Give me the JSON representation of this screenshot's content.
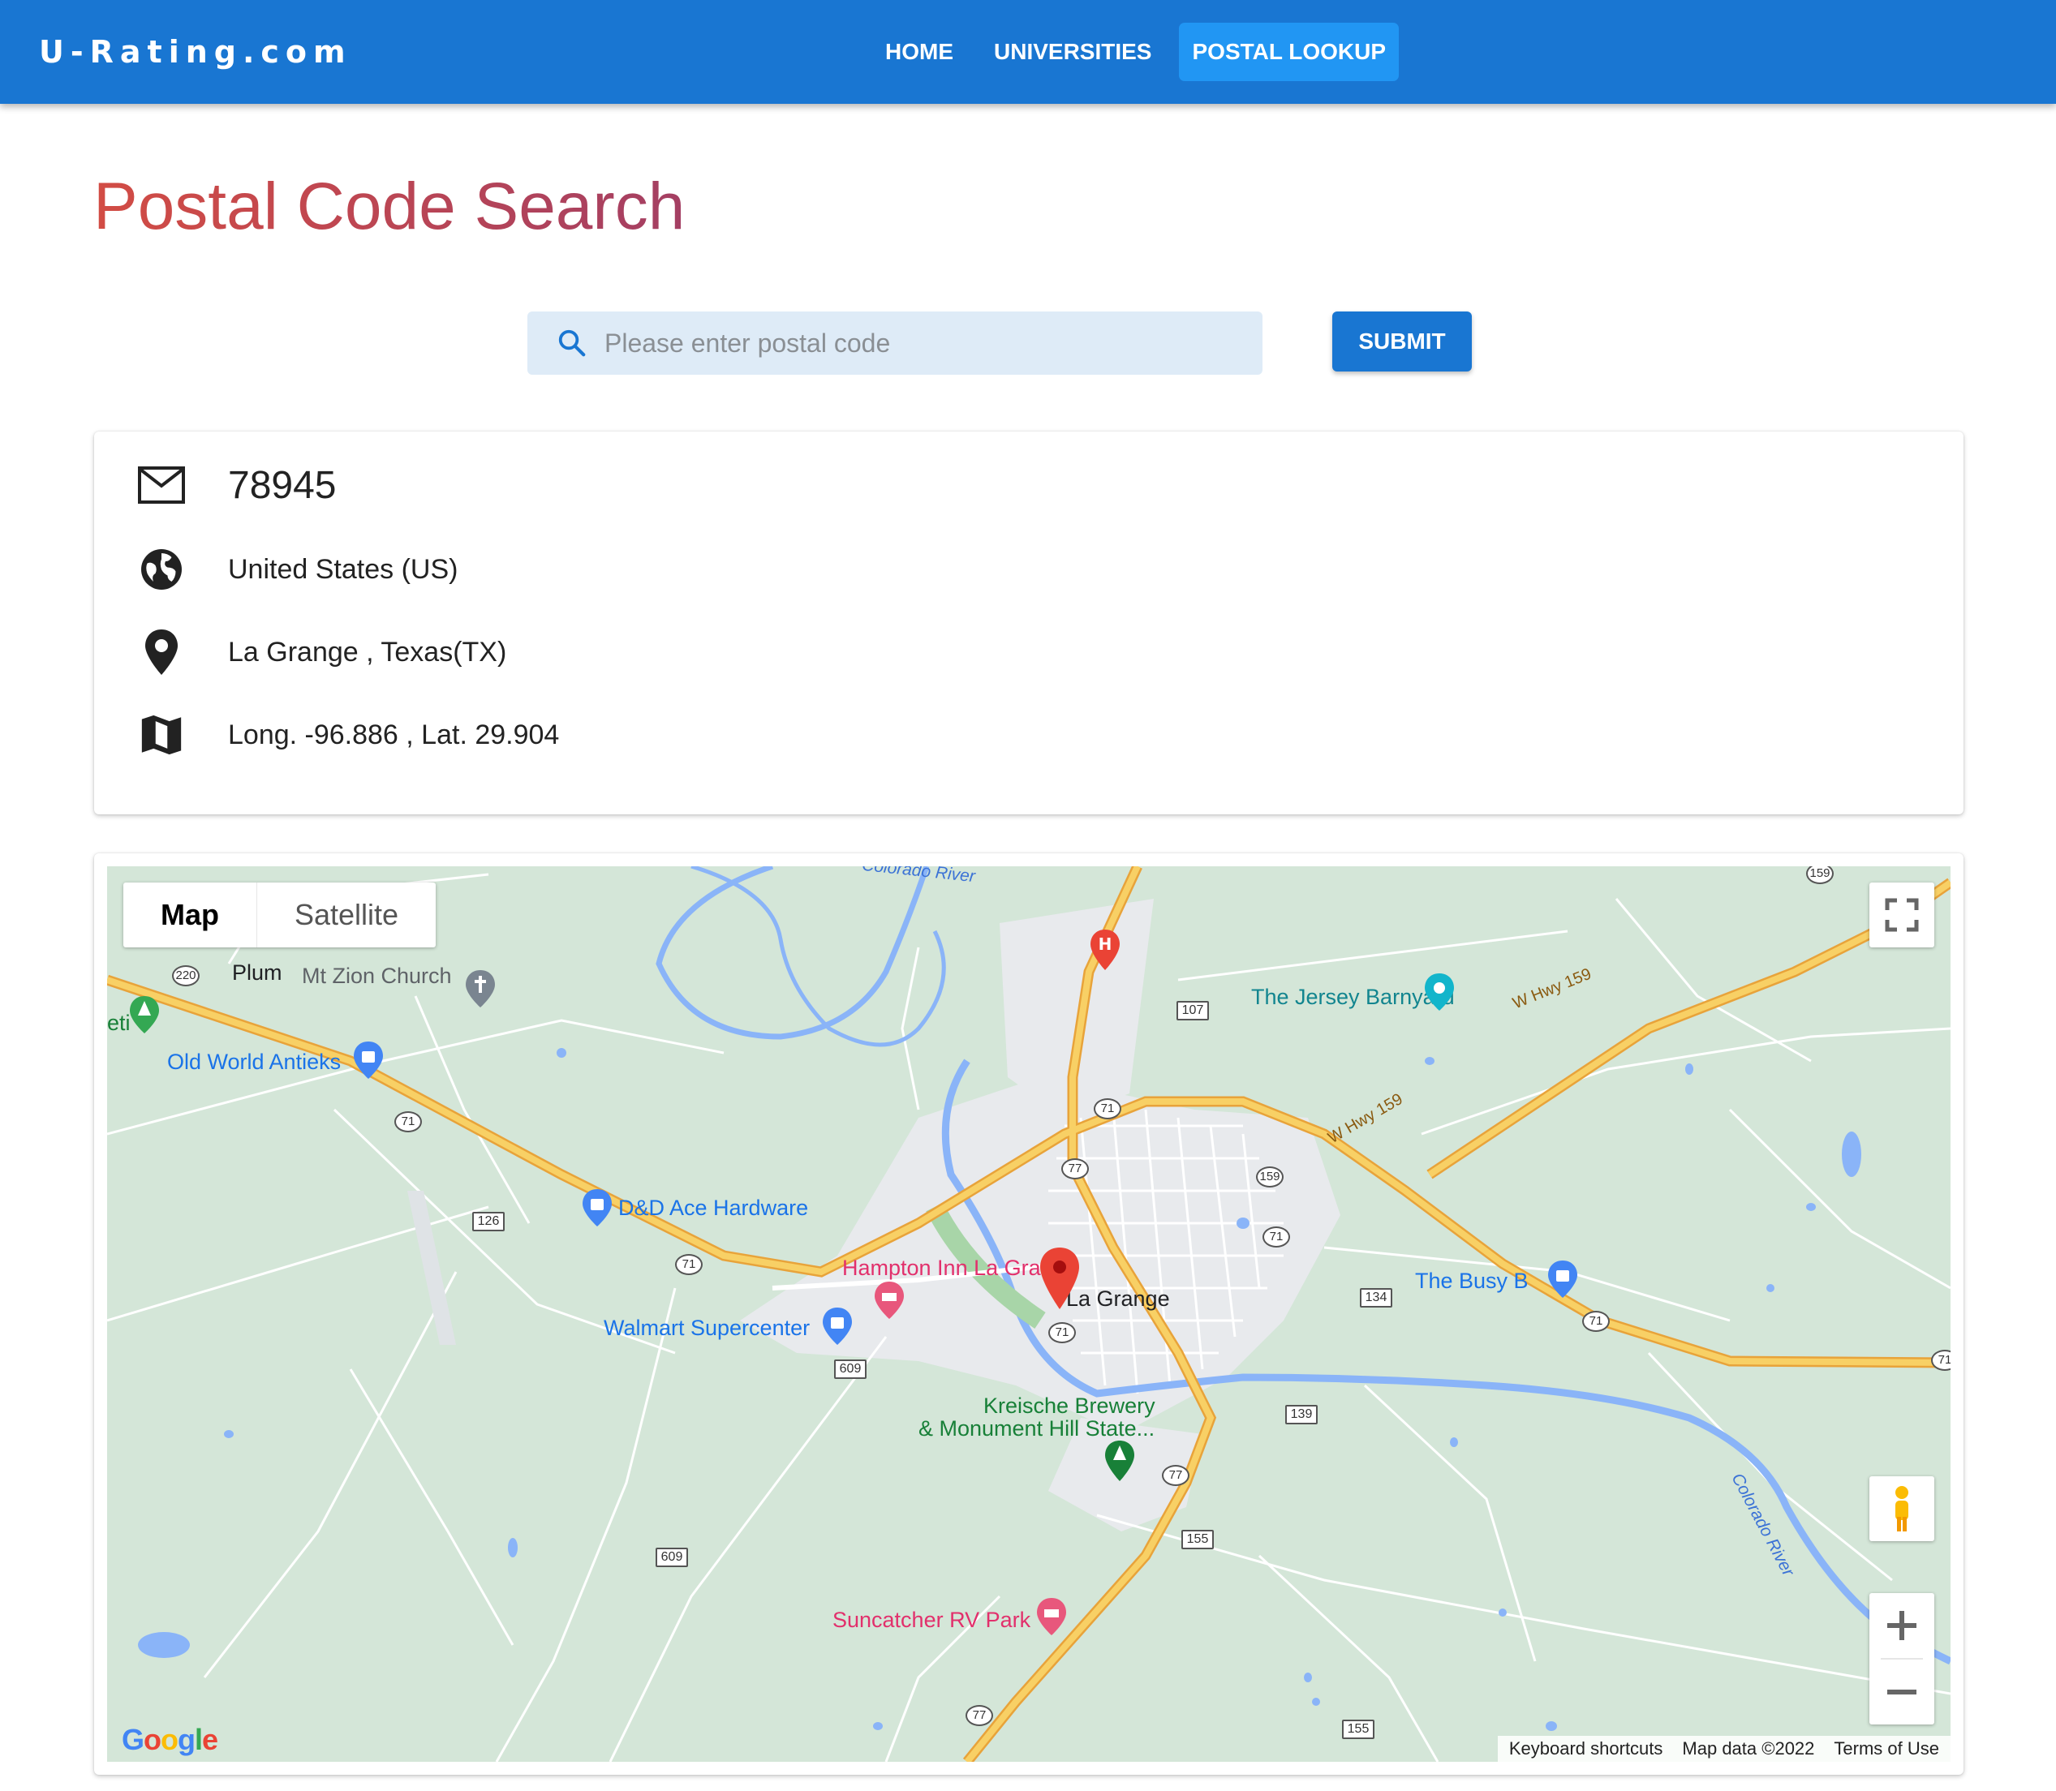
{
  "header": {
    "brand": "U-Rating.com",
    "nav": [
      {
        "label": "HOME",
        "active": false
      },
      {
        "label": "UNIVERSITIES",
        "active": false
      },
      {
        "label": "POSTAL LOOKUP",
        "active": true
      }
    ]
  },
  "page": {
    "title": "Postal Code Search",
    "search": {
      "placeholder": "Please enter postal code",
      "value": ""
    },
    "submit_label": "SUBMIT"
  },
  "result": {
    "postal_code": "78945",
    "country": "United States (US)",
    "place": "La Grange , Texas(TX)",
    "coordinates": "Long. -96.886 , Lat. 29.904",
    "icons": [
      "mail-icon",
      "globe-icon",
      "location-pin-icon",
      "map-icon"
    ]
  },
  "map": {
    "type_options": [
      "Map",
      "Satellite"
    ],
    "selected_type": "Map",
    "labels": {
      "plum": "Plum",
      "mt_zion": "Mt Zion Church",
      "old_world": "Old World Antieks",
      "dd_ace": "D&D Ace Hardware",
      "hampton": "Hampton Inn La Grange",
      "walmart": "Walmart Supercenter",
      "la_grange": "La Grange",
      "kreische_1": "Kreische Brewery",
      "kreische_2": "& Monument Hill State...",
      "suncatcher": "Suncatcher RV Park",
      "jersey": "The Jersey Barnyard",
      "busy_b": "The Busy B",
      "partial_left": "eti",
      "river_top": "Colorado River",
      "river_right": "Colorado River",
      "hwy_159_a": "W Hwy 159",
      "hwy_159_b": "W Hwy 159"
    },
    "route_numbers": {
      "r220": "220",
      "r71a": "71",
      "r126": "126",
      "r71b": "71",
      "r609a": "609",
      "r71c": "71",
      "r71d": "71",
      "r77a": "77",
      "r159a": "159",
      "r71e": "71",
      "r107": "107",
      "r134": "134",
      "r71f": "71",
      "r71g": "71",
      "r139": "139",
      "r77b": "77",
      "r155a": "155",
      "r609b": "609",
      "r77c": "77",
      "r155b": "155",
      "r159b": "159"
    },
    "attribution": [
      "Keyboard shortcuts",
      "Map data ©2022",
      "Terms of Use"
    ],
    "logo": "Google",
    "colors": {
      "land": "#d4e6d8",
      "water": "#8ab4f8",
      "highway": "#f8c04b",
      "town": "#e8eaed",
      "marker": "#ea4335"
    }
  },
  "colors": {
    "appbar": "#1976d2",
    "active_tab": "#2196f3",
    "title_start": "#d24c44",
    "title_end": "#a43f63",
    "search_bg": "#deebf7"
  }
}
